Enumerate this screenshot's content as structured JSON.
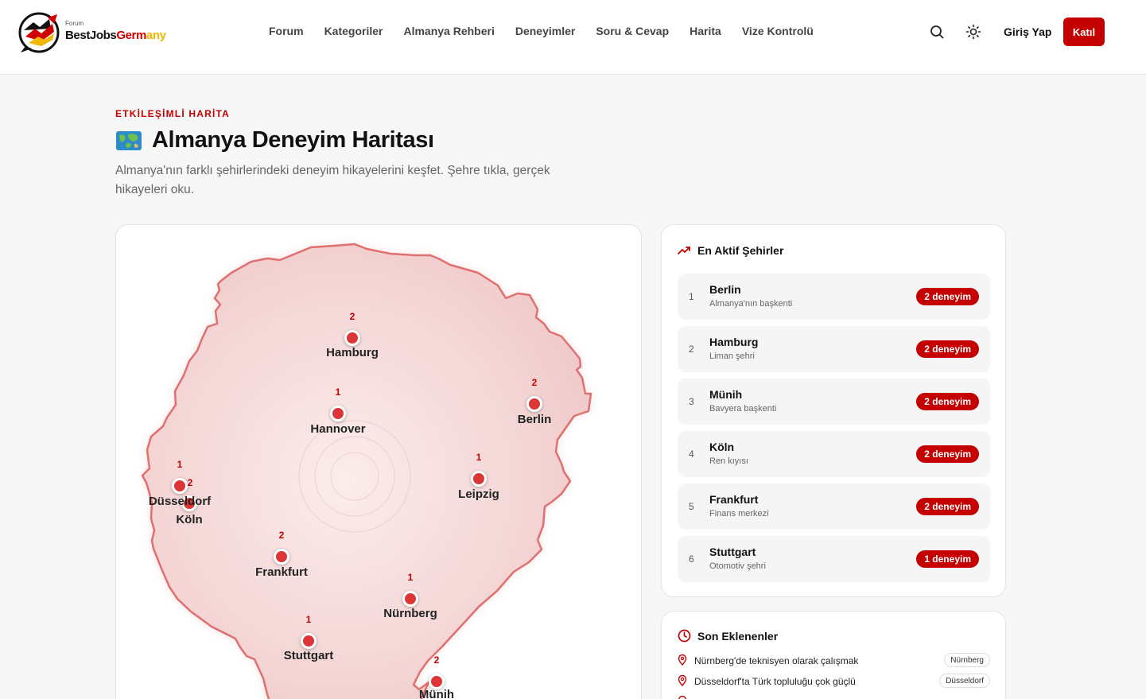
{
  "header": {
    "logo_small": "Forum",
    "logo_part1": "BestJobs",
    "logo_part2": "Germ",
    "logo_part3": "any",
    "nav": [
      "Forum",
      "Kategoriler",
      "Almanya Rehberi",
      "Deneyimler",
      "Soru & Cevap",
      "Harita",
      "Vize Kontrolü"
    ],
    "login": "Giriş Yap",
    "join": "Katıl",
    "icons": [
      "search-icon",
      "sun-icon"
    ]
  },
  "hero": {
    "eyebrow": "ETKİLEŞİMLİ HARİTA",
    "title": "Almanya Deneyim Haritası",
    "subtitle": "Almanya'nın farklı şehirlerindeki deneyim hikayelerini keşfet. Şehre tıkla, gerçek hikayeleri oku."
  },
  "map": {
    "cities": [
      {
        "name": "Hamburg",
        "count": "2"
      },
      {
        "name": "Hannover",
        "count": "1"
      },
      {
        "name": "Berlin",
        "count": "2"
      },
      {
        "name": "Düsseldorf",
        "count": "1"
      },
      {
        "name": "Köln",
        "count": "2"
      },
      {
        "name": "Leipzig",
        "count": "1"
      },
      {
        "name": "Frankfurt",
        "count": "2"
      },
      {
        "name": "Nürnberg",
        "count": "1"
      },
      {
        "name": "Stuttgart",
        "count": "1"
      },
      {
        "name": "Münih",
        "count": "2"
      }
    ],
    "colors": {
      "dot": "#dc3535",
      "outline": "#e07070",
      "fill": "#f6dada"
    }
  },
  "active_cities": {
    "title": "En Aktif Şehirler",
    "items": [
      {
        "rank": "1",
        "name": "Berlin",
        "desc": "Almanya'nın başkenti",
        "badge": "2 deneyim"
      },
      {
        "rank": "2",
        "name": "Hamburg",
        "desc": "Liman şehri",
        "badge": "2 deneyim"
      },
      {
        "rank": "3",
        "name": "Münih",
        "desc": "Bavyera başkenti",
        "badge": "2 deneyim"
      },
      {
        "rank": "4",
        "name": "Köln",
        "desc": "Ren kıyısı",
        "badge": "2 deneyim"
      },
      {
        "rank": "5",
        "name": "Frankfurt",
        "desc": "Finans merkezi",
        "badge": "2 deneyim"
      },
      {
        "rank": "6",
        "name": "Stuttgart",
        "desc": "Otomotiv şehri",
        "badge": "1 deneyim"
      }
    ]
  },
  "recent": {
    "title": "Son Eklenenler",
    "items": [
      {
        "text": "Nürnberg'de teknisyen olarak çalışmak",
        "tag": "Nürnberg"
      },
      {
        "text": "Düsseldorf'ta Türk topluluğu çok güçlü",
        "tag": "Düsseldorf"
      }
    ]
  },
  "accent": "#c40000"
}
